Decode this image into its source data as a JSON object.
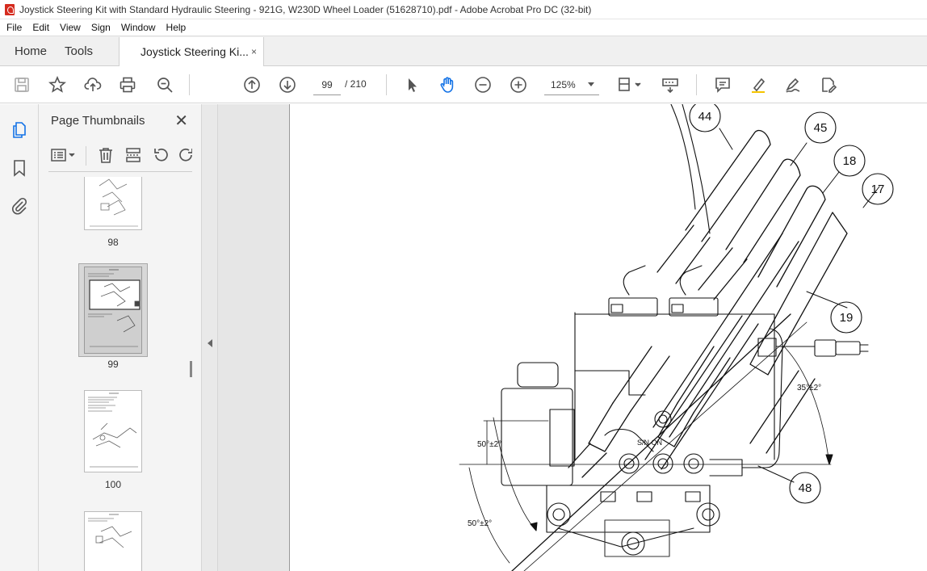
{
  "window": {
    "title": "Joystick Steering Kit with Standard Hydraulic Steering - 921G, W230D Wheel Loader (51628710).pdf - Adobe Acrobat Pro DC (32-bit)"
  },
  "menu": [
    "File",
    "Edit",
    "View",
    "Sign",
    "Window",
    "Help"
  ],
  "tabs": {
    "home": "Home",
    "tools": "Tools",
    "document": "Joystick Steering Ki...",
    "close_glyph": "×"
  },
  "toolbar": {
    "icons": [
      "save-icon",
      "bookmark-star-icon",
      "upload-icon",
      "print-icon",
      "zoom-find-icon",
      "page-up-icon",
      "page-down-icon",
      "select-arrow-icon",
      "hand-pan-icon",
      "zoom-out-icon",
      "zoom-in-icon",
      "fit-page-icon",
      "scroll-mode-icon",
      "comment-icon",
      "highlight-icon",
      "sign-icon",
      "edit-pdf-icon"
    ],
    "current_page": "99",
    "total_pages": "/ 210",
    "zoom": "125%"
  },
  "left_rail": [
    "page-thumbnails-icon",
    "bookmarks-icon",
    "attachments-icon"
  ],
  "thumbnail_panel": {
    "title": "Page Thumbnails",
    "close_glyph": "✕",
    "pages": [
      {
        "label": "98",
        "selected": false
      },
      {
        "label": "99",
        "selected": true
      },
      {
        "label": "100",
        "selected": false
      },
      {
        "label": "",
        "selected": false
      }
    ]
  },
  "drawing": {
    "callouts": [
      "44",
      "45",
      "18",
      "17",
      "19",
      "48"
    ],
    "dimensions": [
      "35°±2°",
      "50°±2°",
      "50°±2°"
    ]
  },
  "colors": {
    "accent_blue": "#1473e6",
    "acrobat_red": "#d52b1e",
    "chrome_bg": "#f4f4f4"
  }
}
